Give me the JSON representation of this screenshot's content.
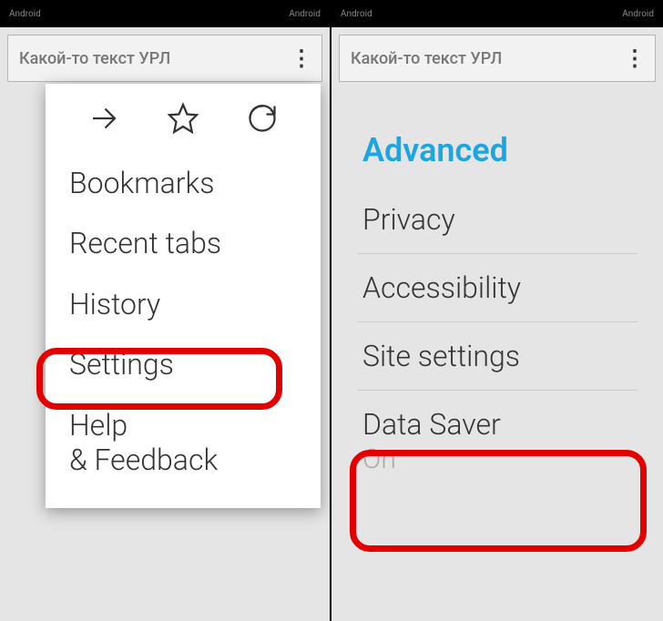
{
  "status": {
    "left": "Android",
    "right": "Android"
  },
  "omnibox": {
    "url": "Какой-то текст УРЛ"
  },
  "menu": {
    "items": [
      {
        "label": "Bookmarks"
      },
      {
        "label": "Recent tabs"
      },
      {
        "label": "History"
      },
      {
        "label": "Settings"
      },
      {
        "label": "Help & Feedback"
      }
    ]
  },
  "settings": {
    "section": "Advanced",
    "rows": [
      {
        "label": "Privacy"
      },
      {
        "label": "Accessibility"
      },
      {
        "label": "Site settings"
      },
      {
        "label": "Data Saver",
        "sub": "On"
      }
    ]
  }
}
